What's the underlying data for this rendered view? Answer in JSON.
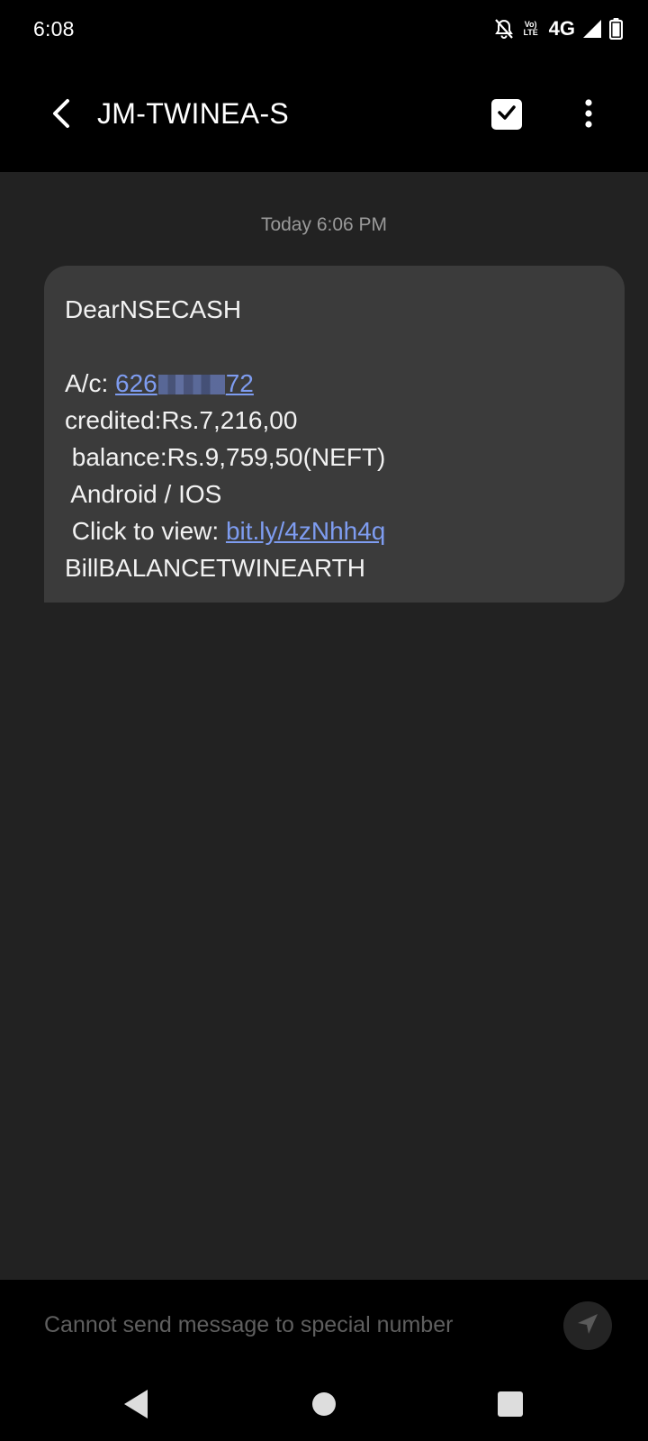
{
  "status_bar": {
    "time": "6:08",
    "network": "4G",
    "volte_top": "Vo)",
    "volte_bottom": "LTE",
    "icons": [
      "mute-notifications-icon",
      "volte-icon",
      "signal-icon",
      "battery-icon"
    ]
  },
  "app_bar": {
    "title": "JM-TWINEA-S",
    "icons": [
      "back-arrow-icon",
      "select-checkbox-icon",
      "more-options-icon"
    ]
  },
  "conversation": {
    "timestamp": "Today 6:06 PM",
    "message": {
      "greeting": "DearNSECASH",
      "account_label": "A/c: ",
      "account_prefix": "626",
      "account_suffix": "72",
      "credited": "credited:Rs.7,216,00",
      "balance": " balance:Rs.9,759,50(NEFT)",
      "platform": " Android / IOS",
      "click_label": " Click to view: ",
      "link": "bit.ly/4zNhh4q",
      "signature": "BillBALANCETWINEARTH"
    }
  },
  "composer": {
    "placeholder": "Cannot send message to special number",
    "send_icon": "send-icon"
  },
  "nav": {
    "icons": [
      "nav-back-icon",
      "nav-home-icon",
      "nav-recents-icon"
    ]
  },
  "colors": {
    "background": "#222222",
    "bars": "#000000",
    "bubble": "#3b3b3b",
    "link": "#7e9cf0",
    "timestamp": "#9a9a9a"
  }
}
